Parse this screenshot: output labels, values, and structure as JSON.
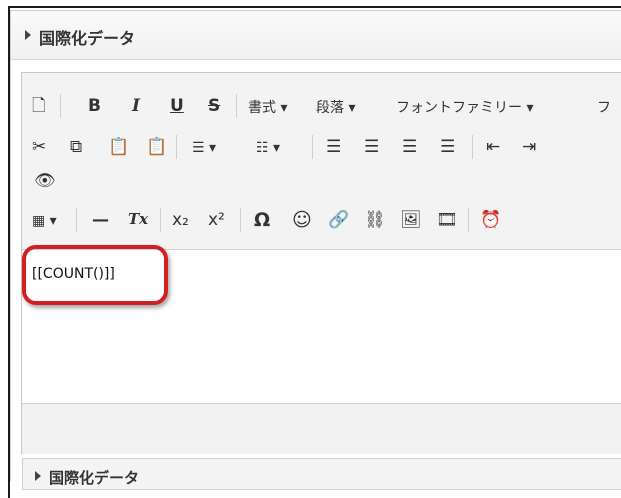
{
  "panel": {
    "title": "国際化データ"
  },
  "toolbar": {
    "new_doc": "🗋",
    "bold": "B",
    "italic": "I",
    "underline": "U",
    "strike": "S",
    "format_dropdown": "書式 ▾",
    "paragraph_dropdown": "段落 ▾",
    "font_family_dropdown": "フォントファミリー ▾",
    "font_size_cut": "フ",
    "cut": "✂",
    "copy": "⧉",
    "paste": "📋",
    "paste_text": "📋",
    "bullet_list": "☰ ▾",
    "numbered_list": "☷ ▾",
    "align_left": "☰",
    "align_center": "☰",
    "align_right": "☰",
    "justify": "☰",
    "outdent": "⇤",
    "indent": "⇥",
    "preview": "👁",
    "table": "▦ ▾",
    "hr": "—",
    "clear_format": "Tx",
    "subscript": "x₂",
    "superscript": "x²",
    "omega": "Ω",
    "emoji": "☺",
    "link": "🔗",
    "unlink": "⛓",
    "image": "🖼",
    "media": "🎞",
    "time": "⏰"
  },
  "editor": {
    "content": "[[COUNT()]]"
  },
  "next_panel": {
    "title": "国際化データ"
  }
}
